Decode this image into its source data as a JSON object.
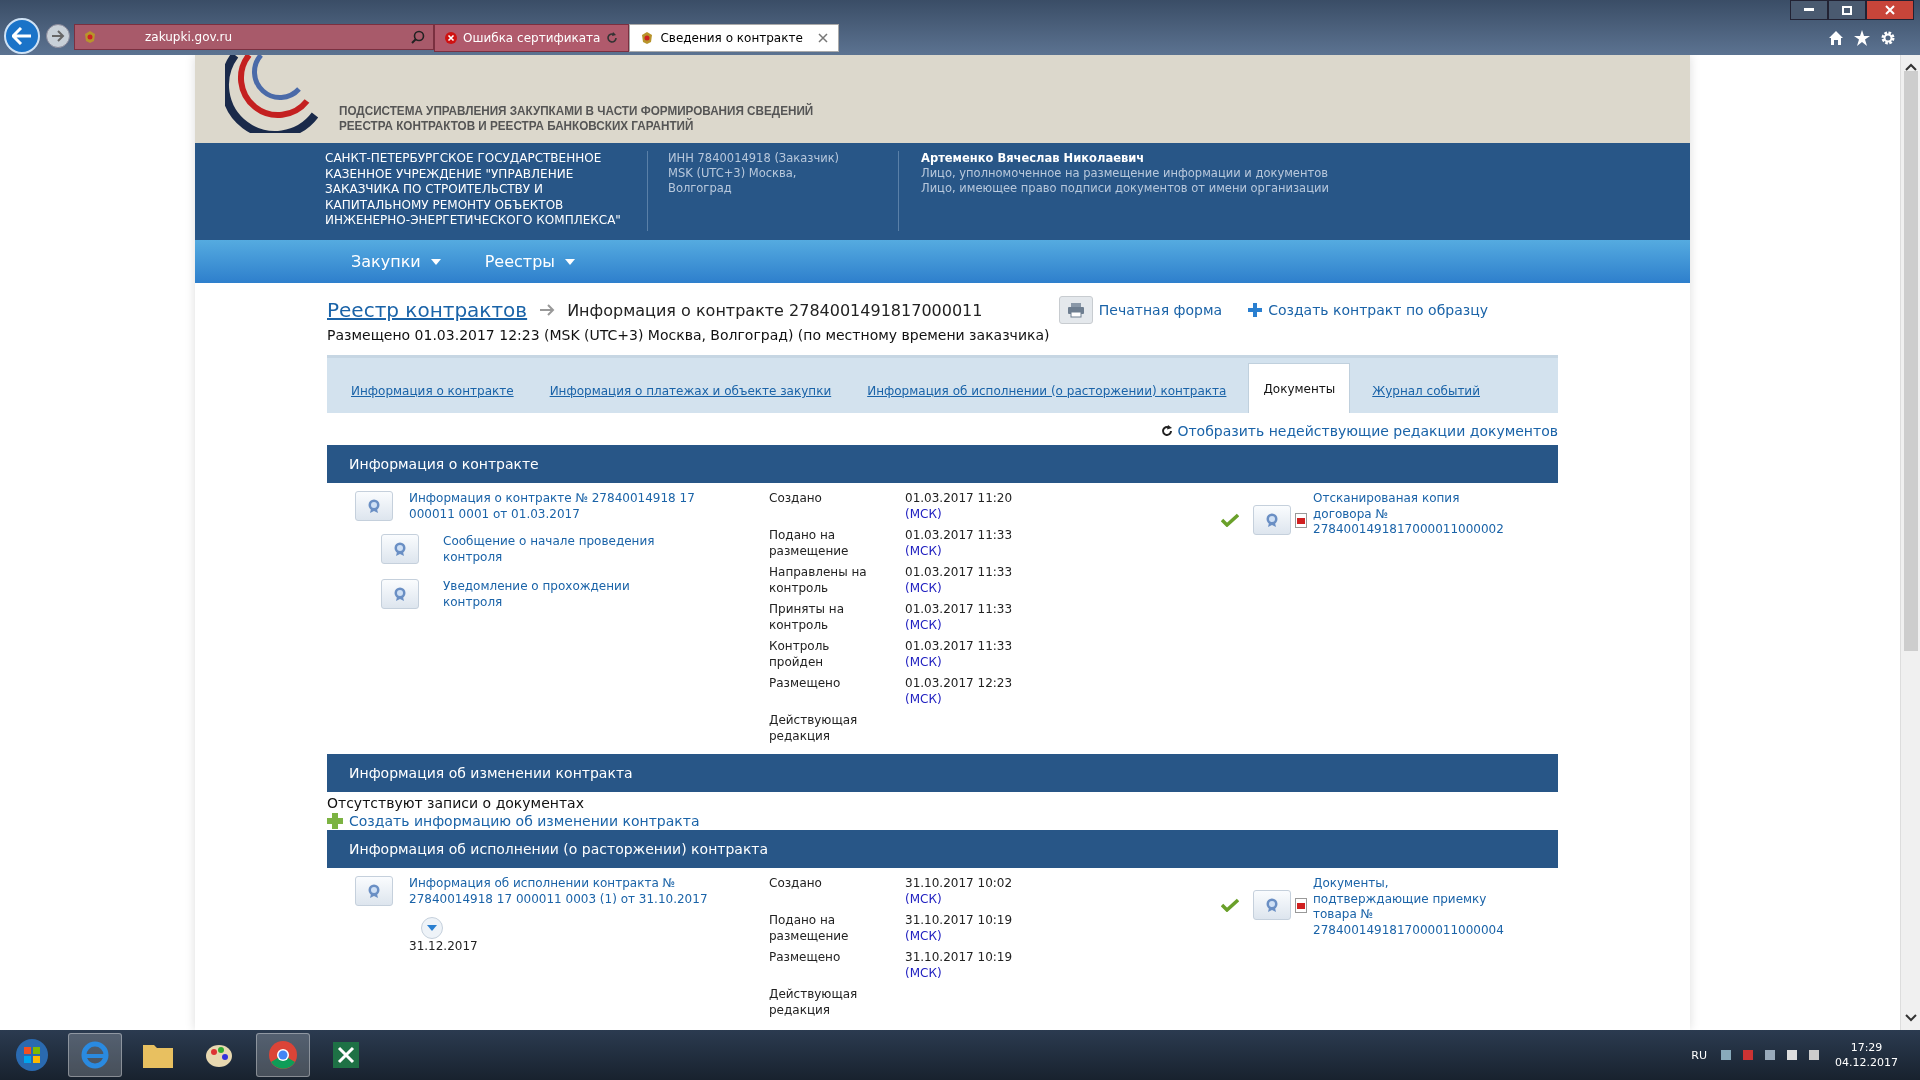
{
  "browser": {
    "address": "zakupki.gov.ru",
    "tabs": [
      {
        "title": "Ошибка сертификата",
        "kind": "error",
        "selected": false
      },
      {
        "title": "Сведения о контракте",
        "kind": "page",
        "selected": true
      }
    ]
  },
  "banner": {
    "subtitle": "ПОДСИСТЕМА УПРАВЛЕНИЯ ЗАКУПКАМИ В ЧАСТИ ФОРМИРОВАНИЯ СВЕДЕНИЙ\nРЕЕСТРА КОНТРАКТОВ И РЕЕСТРА БАНКОВСКИХ ГАРАНТИЙ"
  },
  "org": {
    "name": "САНКТ-ПЕТЕРБУРГСКОЕ ГОСУДАРСТВЕННОЕ\nКАЗЕННОЕ УЧРЕЖДЕНИЕ \"УПРАВЛЕНИЕ\nЗАКАЗЧИКА ПО СТРОИТЕЛЬСТВУ И\nКАПИТАЛЬНОМУ РЕМОНТУ ОБЪЕКТОВ\nИНЖЕНЕРНО-ЭНЕРГЕТИЧЕСКОГО КОМПЛЕКСА\"",
    "inn": "ИНН 7840014918 (Заказчик)",
    "timezone": "MSK (UTC+3) Москва, Волгоград",
    "user": "Артеменко Вячеслав Николаевич",
    "roles": [
      "Лицо, уполномоченное на размещение информации и документов",
      "Лицо, имеющее право подписи документов от имени организации"
    ]
  },
  "nav": [
    {
      "label": "Закупки"
    },
    {
      "label": "Реестры"
    }
  ],
  "breadcrumb": {
    "link": "Реестр контрактов",
    "current": "Информация о контракте 2784001491817000011"
  },
  "actions": [
    {
      "label": "Печатная форма",
      "kind": "print"
    },
    {
      "label": "Создать контракт по образцу",
      "kind": "plus"
    }
  ],
  "published": "Размещено 01.03.2017 12:23 (MSK (UTC+3) Москва, Волгоград) (по местному времени заказчика)",
  "tabs": [
    {
      "label": "Информация о контракте",
      "selected": false
    },
    {
      "label": "Информация о платежах и объекте закупки",
      "selected": false
    },
    {
      "label": "Информация об исполнении (о расторжении) контракта",
      "selected": false
    },
    {
      "label": "Документы",
      "selected": true
    },
    {
      "label": "Журнал событий",
      "selected": false
    }
  ],
  "show_inactive": "Отобразить недействующие редакции документов",
  "sections": [
    {
      "title": "Информация о контракте",
      "kind": "records",
      "document": "Информация о контракте № 27840014918 17\n000011 0001 от 01.03.2017",
      "subdocuments": [
        "Сообщение о начале проведения\nконтроля",
        "Уведомление о прохождении\nконтроля"
      ],
      "statuses": [
        {
          "label": "Создано",
          "time": "01.03.2017 11:20",
          "zone": "(МСК)"
        },
        {
          "label": "Подано на\nразмещение",
          "time": "01.03.2017 11:33",
          "zone": "(МСК)"
        },
        {
          "label": "Направлены на\nконтроль",
          "time": "01.03.2017 11:33",
          "zone": "(МСК)"
        },
        {
          "label": "Приняты на\nконтроль",
          "time": "01.03.2017 11:33",
          "zone": "(МСК)"
        },
        {
          "label": "Контроль\nпройден",
          "time": "01.03.2017 11:33",
          "zone": "(МСК)"
        },
        {
          "label": "Размещено",
          "time": "01.03.2017 12:23",
          "zone": "(МСК)"
        },
        {
          "label": "Действующая\nредакция"
        }
      ],
      "attachment": {
        "title": "Отсканированая копия\nдоговора №\n2784001491817000011000002",
        "verified": true
      }
    },
    {
      "title": "Информация об изменении контракта",
      "kind": "empty",
      "message": "Отсутствуют записи о документах",
      "create": "Создать информацию об изменении контракта"
    },
    {
      "title": "Информация об исполнении (о расторжении) контракта",
      "kind": "records",
      "document": "Информация об исполнении контракта №\n27840014918 17 000011 0003 (1) от 31.10.2017",
      "expand": true,
      "date": "31.12.2017",
      "statuses": [
        {
          "label": "Создано",
          "time": "31.10.2017 10:02",
          "zone": "(МСК)"
        },
        {
          "label": "Подано на\nразмещение",
          "time": "31.10.2017 10:19",
          "zone": "(МСК)"
        },
        {
          "label": "Размещено",
          "time": "31.10.2017 10:19",
          "zone": "(МСК)"
        },
        {
          "label": "Действующая\nредакция"
        }
      ],
      "attachment": {
        "title": "Документы,\nподтверждающие приемку\nтовара №\n2784001491817000011000004",
        "verified": true
      }
    }
  ],
  "taskbar": {
    "lang": "RU",
    "time": "17:29",
    "date": "04.12.2017"
  }
}
